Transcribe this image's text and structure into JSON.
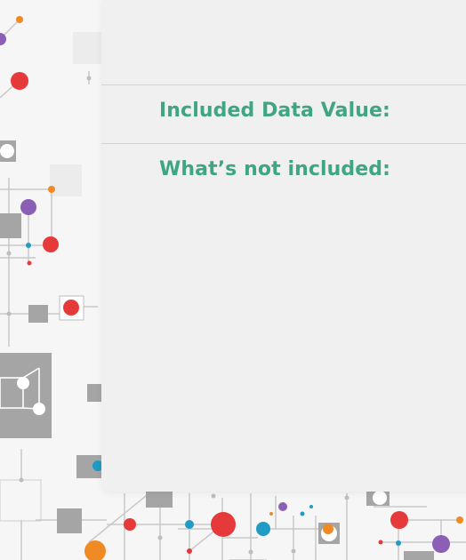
{
  "sections": {
    "included": {
      "heading": "Included Data Value:"
    },
    "not_included": {
      "heading": "What’s not included:"
    }
  },
  "colors": {
    "accent_heading": "#3fa584",
    "panel_bg": "#f0f0f0",
    "node_red": "#e63a3a",
    "node_purple": "#8b5fb5",
    "node_orange": "#f08a24",
    "node_blue": "#1f9bc4",
    "node_gray": "#a5a5a5"
  },
  "background": {
    "icon": "circuit-board-pattern"
  }
}
